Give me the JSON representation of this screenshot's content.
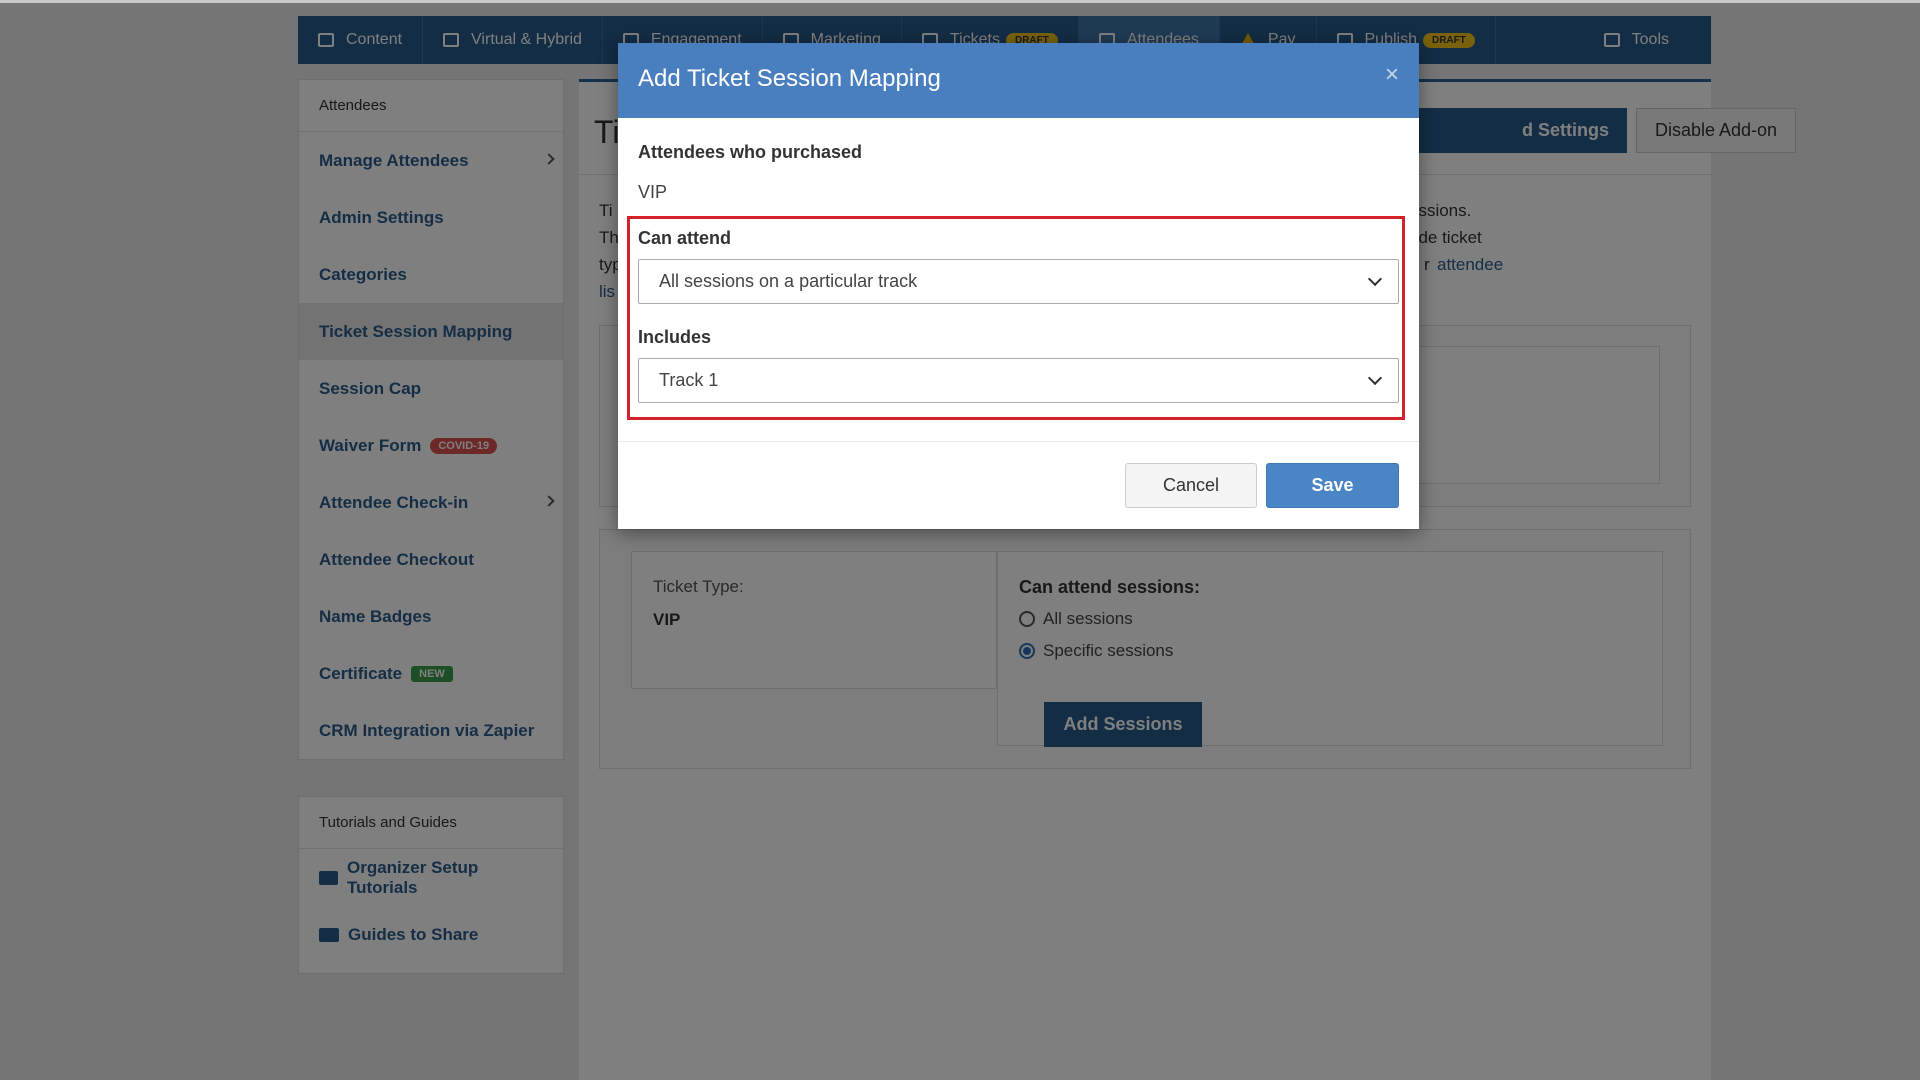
{
  "nav": {
    "items": [
      {
        "label": "Content",
        "icon": "content-icon"
      },
      {
        "label": "Virtual & Hybrid",
        "icon": "laptop-icon"
      },
      {
        "label": "Engagement",
        "icon": "engagement-icon"
      },
      {
        "label": "Marketing",
        "icon": "marketing-icon"
      },
      {
        "label": "Tickets",
        "icon": "ticket-icon",
        "badge": "DRAFT"
      },
      {
        "label": "Attendees",
        "icon": "users-icon"
      },
      {
        "label": "Pay",
        "icon": "warning-icon"
      },
      {
        "label": "Publish",
        "icon": "globe-icon",
        "badge": "DRAFT"
      },
      {
        "label": "Tools",
        "icon": "toolbox-icon"
      }
    ]
  },
  "sidebar": {
    "header": "Attendees",
    "items": [
      {
        "label": "Manage Attendees"
      },
      {
        "label": "Admin Settings"
      },
      {
        "label": "Categories"
      },
      {
        "label": "Ticket Session Mapping"
      },
      {
        "label": "Session Cap"
      },
      {
        "label": "Waiver Form",
        "badge": "COVID-19"
      },
      {
        "label": "Attendee Check-in"
      },
      {
        "label": "Attendee Checkout"
      },
      {
        "label": "Name Badges"
      },
      {
        "label": "Certificate",
        "badge": "NEW"
      },
      {
        "label": "CRM Integration via Zapier"
      }
    ]
  },
  "tutorials": {
    "header": "Tutorials and Guides",
    "items": [
      {
        "label": "Organizer Setup Tutorials",
        "icon": "graduation-cap-icon"
      },
      {
        "label": "Guides to Share",
        "icon": "share-screen-icon"
      }
    ]
  },
  "main": {
    "title_partial": "Ti",
    "settings_button_partial": "d Settings",
    "disable_button": "Disable Add-on",
    "desc_lines": [
      "Ti",
      "Th",
      "typ",
      "lis"
    ],
    "desc_right_lines": [
      "essions.",
      "ude ticket",
      "r "
    ],
    "desc_link": "attendee",
    "ticket_type_label": "Ticket Type:",
    "ticket_type_value": "VIP",
    "can_attend_label": "Can attend sessions:",
    "radio_all": "All sessions",
    "radio_specific": "Specific sessions",
    "add_sessions_button": "Add Sessions"
  },
  "modal": {
    "title": "Add Ticket Session Mapping",
    "close": "×",
    "purchased_label": "Attendees who purchased",
    "purchased_value": "VIP",
    "can_attend_label": "Can attend",
    "can_attend_value": "All sessions on a particular track",
    "includes_label": "Includes",
    "includes_value": "Track 1",
    "cancel": "Cancel",
    "save": "Save"
  }
}
